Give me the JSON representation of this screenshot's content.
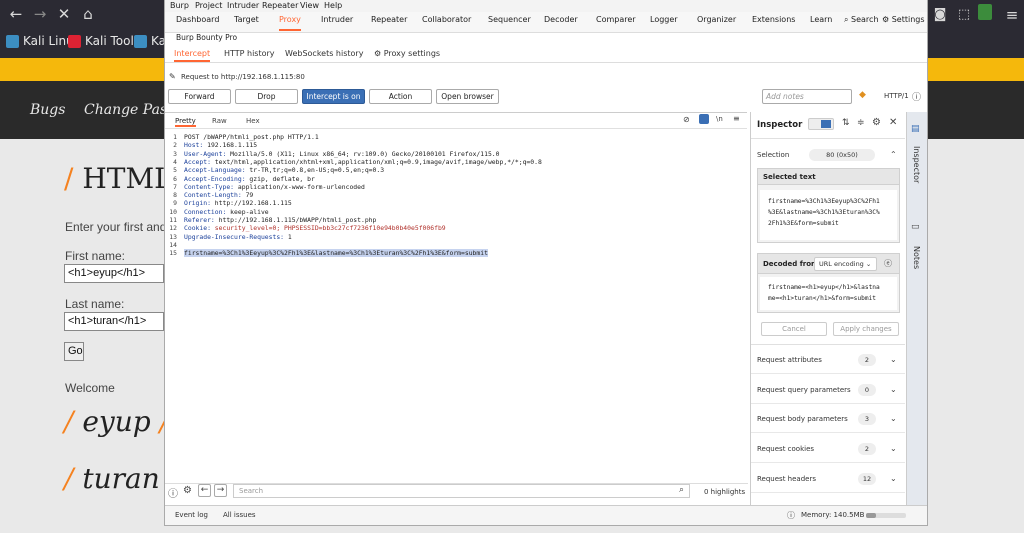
{
  "browser": {
    "bookmarks": [
      "Kali Linux",
      "Kali Tools",
      "Kal"
    ]
  },
  "site": {
    "nav": [
      "Bugs",
      "Change Passw"
    ],
    "heading": "HTML",
    "intro": "Enter your first and la",
    "first_label": "First name:",
    "first_value": "<h1>eyup</h1>",
    "last_label": "Last name:",
    "last_value": "<h1>turan</h1>",
    "go_label": "Go",
    "welcome": "Welcome",
    "out1": "eyup",
    "out2": "turan"
  },
  "burp": {
    "menu": [
      "Burp",
      "Project",
      "Intruder",
      "Repeater",
      "View",
      "Help"
    ],
    "tabs": [
      "Dashboard",
      "Target",
      "Proxy",
      "Intruder",
      "Repeater",
      "Collaborator",
      "Sequencer",
      "Decoder",
      "Comparer",
      "Logger",
      "Organizer",
      "Extensions",
      "Learn"
    ],
    "search_label": "Search",
    "settings_label": "Settings",
    "extra_tab": "Burp Bounty Pro",
    "subtabs": [
      "Intercept",
      "HTTP history",
      "WebSockets history"
    ],
    "proxy_settings": "Proxy settings",
    "request_to": "Request to http://192.168.1.115:80",
    "buttons": [
      "Forward",
      "Drop",
      "Intercept is on",
      "Action",
      "Open browser"
    ],
    "notes_placeholder": "Add notes",
    "http_version": "HTTP/1",
    "view_tabs": [
      "Pretty",
      "Raw",
      "Hex"
    ],
    "lines": [
      {
        "n": "1",
        "k": "",
        "v": "POST /bWAPP/htmli_post.php HTTP/1.1"
      },
      {
        "n": "2",
        "k": "Host:",
        "v": " 192.168.1.115"
      },
      {
        "n": "3",
        "k": "User-Agent:",
        "v": " Mozilla/5.0 (X11; Linux x86_64; rv:109.0) Gecko/20100101 Firefox/115.0"
      },
      {
        "n": "4",
        "k": "Accept:",
        "v": " text/html,application/xhtml+xml,application/xml;q=0.9,image/avif,image/webp,*/*;q=0.8"
      },
      {
        "n": "5",
        "k": "Accept-Language:",
        "v": " tr-TR,tr;q=0.8,en-US;q=0.5,en;q=0.3"
      },
      {
        "n": "6",
        "k": "Accept-Encoding:",
        "v": " gzip, deflate, br"
      },
      {
        "n": "7",
        "k": "Content-Type:",
        "v": " application/x-www-form-urlencoded"
      },
      {
        "n": "8",
        "k": "Content-Length:",
        "v": " 79"
      },
      {
        "n": "9",
        "k": "Origin:",
        "v": " http://192.168.1.115"
      },
      {
        "n": "10",
        "k": "Connection:",
        "v": " keep-alive"
      },
      {
        "n": "11",
        "k": "Referer:",
        "v": " http://192.168.1.115/bWAPP/htmli_post.php"
      },
      {
        "n": "12",
        "k": "Cookie:",
        "v": " security_level=0; PHPSESSID=bb3c27cf7236f10e94b0b40e5f006fb9"
      },
      {
        "n": "13",
        "k": "Upgrade-Insecure-Requests:",
        "v": " 1"
      },
      {
        "n": "14",
        "k": "",
        "v": ""
      },
      {
        "n": "15",
        "k": "",
        "v": "firstname=%3Ch1%3Eeyup%3C%2Fh1%3E&lastname=%3Ch1%3Eturan%3C%2Fh1%3E&form=submit"
      }
    ],
    "search_placeholder": "Search",
    "highlights": "0 highlights",
    "status_event_log": "Event log",
    "status_all_issues": "All issues",
    "memory": "Memory: 140.5MB"
  },
  "inspector": {
    "title": "Inspector",
    "selection_label": "Selection",
    "selection_value": "80 (0x50)",
    "selected_text_label": "Selected text",
    "selected_text": [
      "firstname=%3Ch1%3Eeyup%3C%2Fh1",
      "%3E&lastname=%3Ch1%3Eturan%3C%",
      "2Fh1%3E&form=submit"
    ],
    "decoded_from_label": "Decoded from:",
    "decoded_from_value": "URL encoding",
    "decoded_text": [
      "firstname=<h1>eyup</h1>&lastna",
      "me=<h1>turan</h1>&form=submit"
    ],
    "cancel": "Cancel",
    "apply": "Apply changes",
    "rows": [
      {
        "label": "Request attributes",
        "count": "2"
      },
      {
        "label": "Request query parameters",
        "count": "0"
      },
      {
        "label": "Request body parameters",
        "count": "3"
      },
      {
        "label": "Request cookies",
        "count": "2"
      },
      {
        "label": "Request headers",
        "count": "12"
      }
    ],
    "side_tabs": [
      "Inspector",
      "Notes"
    ]
  }
}
